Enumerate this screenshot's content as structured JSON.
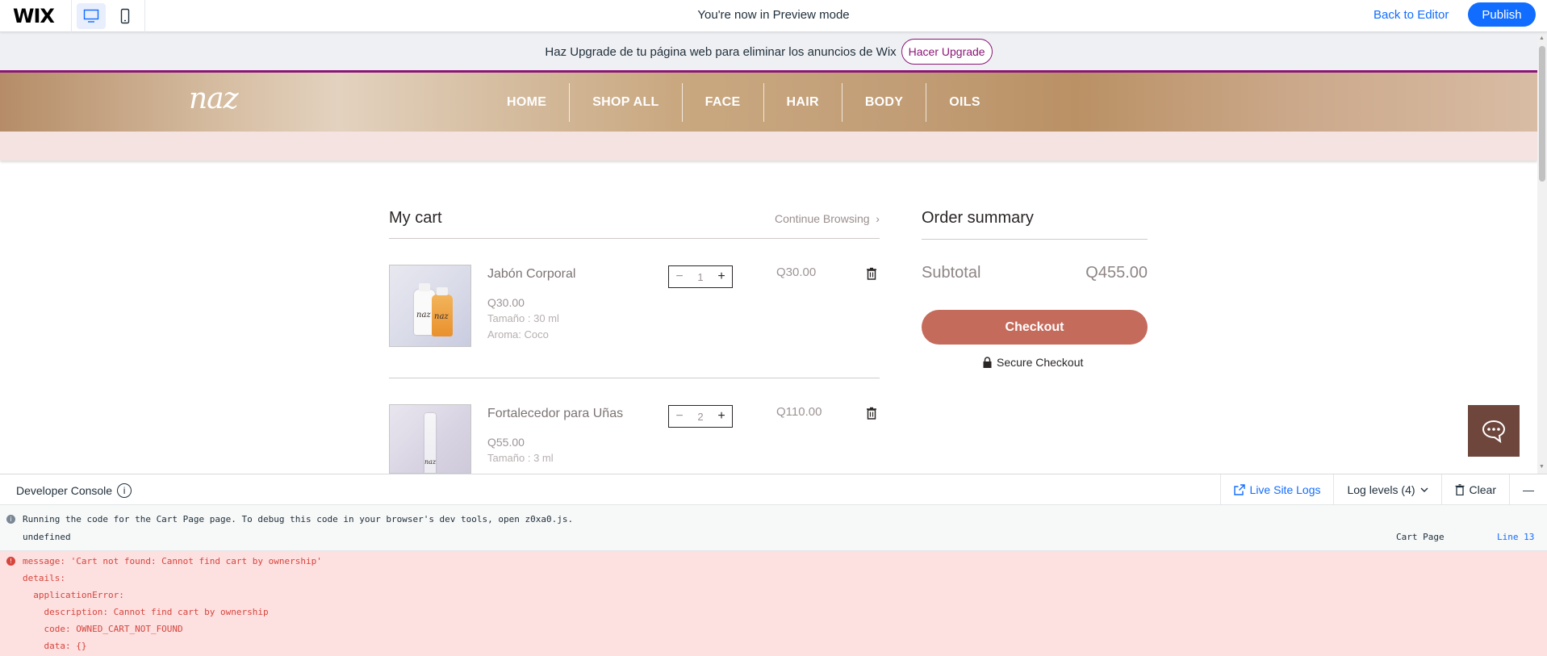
{
  "wix_bar": {
    "logo": "WIX",
    "preview_message": "You're now in Preview mode",
    "back_to_editor": "Back to Editor",
    "publish": "Publish",
    "accent": "#116dff"
  },
  "upgrade_banner": {
    "text": "Haz Upgrade de tu página web para eliminar los anuncios de Wix",
    "button": "Hacer Upgrade"
  },
  "site": {
    "brand": "naz",
    "nav": [
      "HOME",
      "SHOP ALL",
      "FACE",
      "HAIR",
      "BODY",
      "OILS"
    ]
  },
  "cart": {
    "title": "My cart",
    "continue_browsing": "Continue Browsing",
    "items": [
      {
        "name": "Jabón Corporal",
        "price": "Q30.00",
        "options": [
          "Tamaño : 30 ml",
          "Aroma: Coco"
        ],
        "quantity": "1",
        "total": "Q30.00",
        "image_label": "naz"
      },
      {
        "name": "Fortalecedor para Uñas",
        "price": "Q55.00",
        "options": [
          "Tamaño : 3 ml"
        ],
        "quantity": "2",
        "total": "Q110.00",
        "image_label": "naz"
      }
    ]
  },
  "summary": {
    "title": "Order summary",
    "subtotal_label": "Subtotal",
    "subtotal_value": "Q455.00",
    "checkout": "Checkout",
    "secure": "Secure Checkout",
    "checkout_color": "#c46b5c"
  },
  "console": {
    "title": "Developer Console",
    "live_logs": "Live Site Logs",
    "log_levels": "Log levels (4)",
    "clear": "Clear",
    "info_line": "Running the code for the Cart Page page. To debug this code in your browser's dev tools, open z0xa0.js.",
    "undefined_line": "undefined",
    "page_name": "Cart Page",
    "line_ref": "Line 13",
    "error_lines": [
      "message: 'Cart not found: Cannot find cart by ownership'",
      "details:",
      "  applicationError:",
      "    description: Cannot find cart by ownership",
      "    code: OWNED_CART_NOT_FOUND",
      "    data: {}"
    ]
  }
}
